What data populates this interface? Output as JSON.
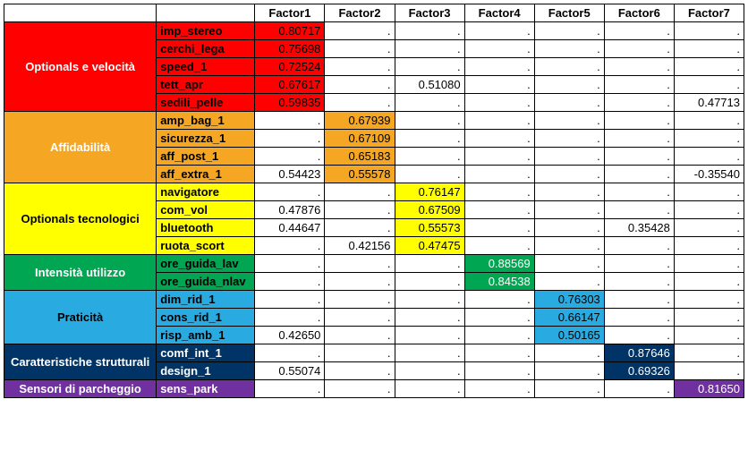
{
  "headers": [
    "Factor1",
    "Factor2",
    "Factor3",
    "Factor4",
    "Factor5",
    "Factor6",
    "Factor7"
  ],
  "groups": [
    {
      "label": "Optionals e velocità",
      "color": "red",
      "labelDark": false,
      "rows": [
        {
          "var": "imp_stereo",
          "vals": [
            "0.80717",
            ".",
            ".",
            ".",
            ".",
            ".",
            "."
          ],
          "hl": [
            0
          ]
        },
        {
          "var": "cerchi_lega",
          "vals": [
            "0.75698",
            ".",
            ".",
            ".",
            ".",
            ".",
            "."
          ],
          "hl": [
            0
          ]
        },
        {
          "var": "speed_1",
          "vals": [
            "0.72524",
            ".",
            ".",
            ".",
            ".",
            ".",
            "."
          ],
          "hl": [
            0
          ]
        },
        {
          "var": "tett_apr",
          "vals": [
            "0.67617",
            ".",
            "0.51080",
            ".",
            ".",
            ".",
            "."
          ],
          "hl": [
            0
          ]
        },
        {
          "var": "sedili_pelle",
          "vals": [
            "0.59835",
            ".",
            ".",
            ".",
            ".",
            ".",
            "0.47713"
          ],
          "hl": [
            0
          ]
        }
      ]
    },
    {
      "label": "Affidabilità",
      "color": "orange",
      "labelDark": false,
      "rows": [
        {
          "var": "amp_bag_1",
          "vals": [
            ".",
            "0.67939",
            ".",
            ".",
            ".",
            ".",
            "."
          ],
          "hl": [
            1
          ]
        },
        {
          "var": "sicurezza_1",
          "vals": [
            ".",
            "0.67109",
            ".",
            ".",
            ".",
            ".",
            "."
          ],
          "hl": [
            1
          ]
        },
        {
          "var": "aff_post_1",
          "vals": [
            ".",
            "0.65183",
            ".",
            ".",
            ".",
            ".",
            "."
          ],
          "hl": [
            1
          ]
        },
        {
          "var": "aff_extra_1",
          "vals": [
            "0.54423",
            "0.55578",
            ".",
            ".",
            ".",
            ".",
            "-0.35540"
          ],
          "hl": [
            1
          ]
        }
      ]
    },
    {
      "label": "Optionals tecnologici",
      "color": "yellow",
      "labelDark": true,
      "rows": [
        {
          "var": "navigatore",
          "vals": [
            ".",
            ".",
            "0.76147",
            ".",
            ".",
            ".",
            "."
          ],
          "hl": [
            2
          ]
        },
        {
          "var": "com_vol",
          "vals": [
            "0.47876",
            ".",
            "0.67509",
            ".",
            ".",
            ".",
            "."
          ],
          "hl": [
            2
          ]
        },
        {
          "var": "bluetooth",
          "vals": [
            "0.44647",
            ".",
            "0.55573",
            ".",
            ".",
            "0.35428",
            "."
          ],
          "hl": [
            2
          ]
        },
        {
          "var": "ruota_scort",
          "vals": [
            ".",
            "0.42156",
            "0.47475",
            ".",
            ".",
            ".",
            "."
          ],
          "hl": [
            2
          ]
        }
      ]
    },
    {
      "label": "Intensità utilizzo",
      "color": "green",
      "labelDark": false,
      "rows": [
        {
          "var": "ore_guida_lav",
          "vals": [
            ".",
            ".",
            ".",
            "0.88569",
            ".",
            ".",
            "."
          ],
          "hl": [
            3
          ]
        },
        {
          "var": "ore_guida_nlav",
          "vals": [
            ".",
            ".",
            ".",
            "0.84538",
            ".",
            ".",
            "."
          ],
          "hl": [
            3
          ]
        }
      ]
    },
    {
      "label": "Praticità",
      "color": "sky",
      "labelDark": true,
      "rows": [
        {
          "var": "dim_rid_1",
          "vals": [
            ".",
            ".",
            ".",
            ".",
            "0.76303",
            ".",
            "."
          ],
          "hl": [
            4
          ]
        },
        {
          "var": "cons_rid_1",
          "vals": [
            ".",
            ".",
            ".",
            ".",
            "0.66147",
            ".",
            "."
          ],
          "hl": [
            4
          ]
        },
        {
          "var": "risp_amb_1",
          "vals": [
            "0.42650",
            ".",
            ".",
            ".",
            "0.50165",
            ".",
            "."
          ],
          "hl": [
            4
          ]
        }
      ]
    },
    {
      "label": "Caratteristiche strutturali",
      "color": "navy",
      "labelDark": false,
      "rows": [
        {
          "var": "comf_int_1",
          "vals": [
            ".",
            ".",
            ".",
            ".",
            ".",
            "0.87646",
            "."
          ],
          "hl": [
            5
          ]
        },
        {
          "var": "design_1",
          "vals": [
            "0.55074",
            ".",
            ".",
            ".",
            ".",
            "0.69326",
            "."
          ],
          "hl": [
            5
          ]
        }
      ]
    },
    {
      "label": "Sensori di parcheggio",
      "color": "purple",
      "labelDark": false,
      "rows": [
        {
          "var": "sens_park",
          "vals": [
            ".",
            ".",
            ".",
            ".",
            ".",
            ".",
            "0.81650"
          ],
          "hl": [
            6
          ]
        }
      ]
    }
  ]
}
